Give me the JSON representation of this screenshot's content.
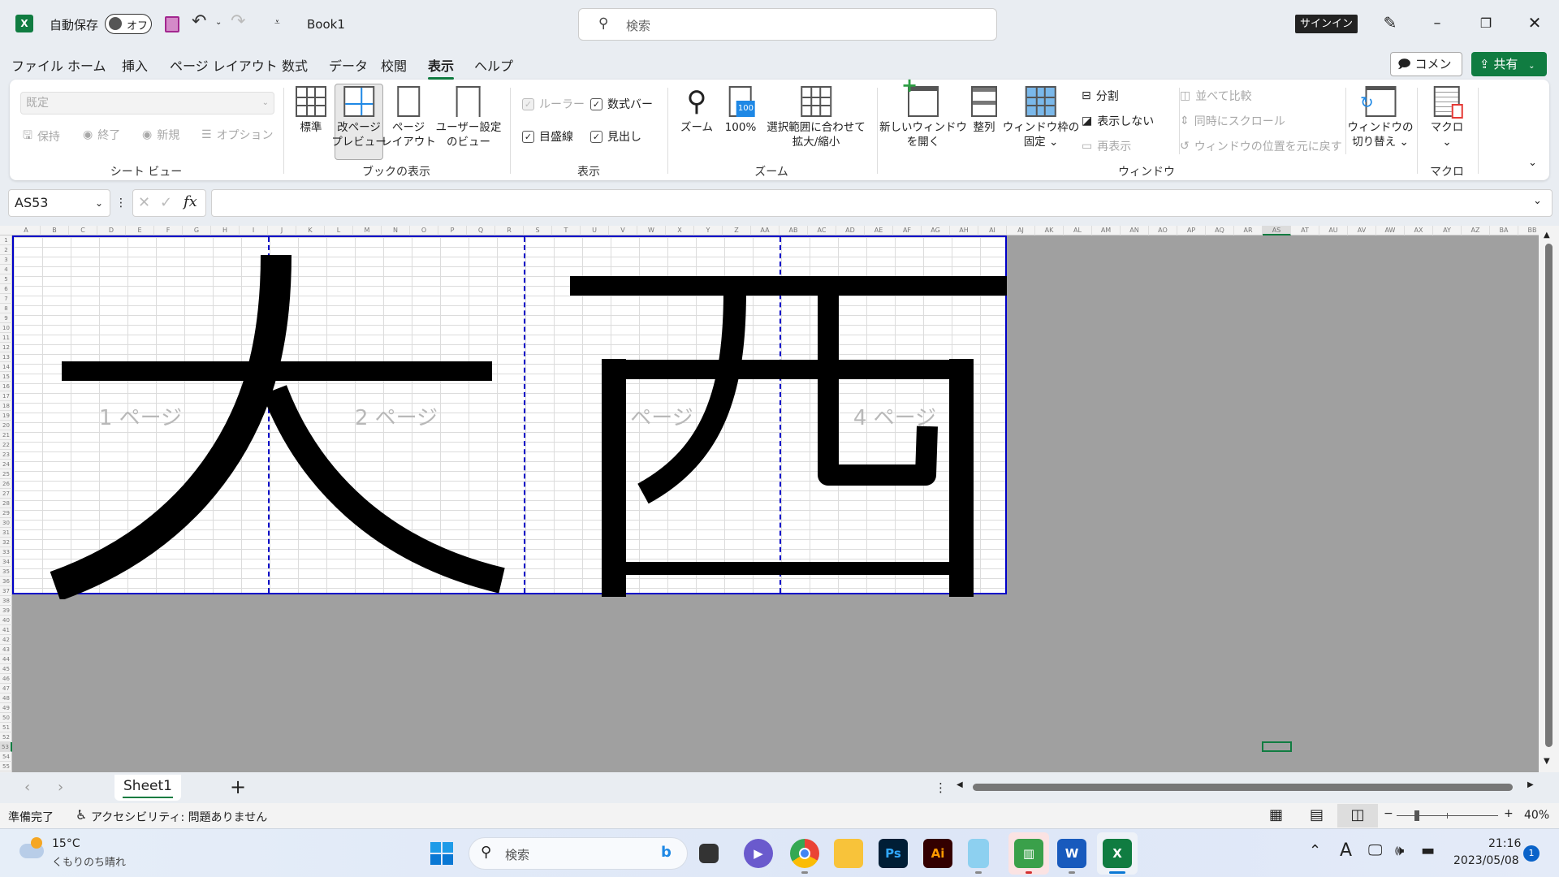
{
  "titlebar": {
    "autosave_label": "自動保存",
    "autosave_state": "オフ",
    "doc_title": "Book1",
    "search_placeholder": "検索",
    "signin": "サインイン"
  },
  "menu": {
    "tabs": [
      "ファイル",
      "ホーム",
      "挿入",
      "ページ レイアウト",
      "数式",
      "データ",
      "校閲",
      "表示",
      "ヘルプ"
    ],
    "active_tab": "表示",
    "comment": "コメント",
    "share": "共有"
  },
  "ribbon": {
    "sheet_view": {
      "combo_value": "既定",
      "keep": "保持",
      "exit": "終了",
      "new": "新規",
      "options": "オプション",
      "label": "シート ビュー"
    },
    "workbook_views": {
      "normal": "標準",
      "page_break_1": "改ページ",
      "page_break_2": "プレビュー",
      "page_layout_1": "ページ",
      "page_layout_2": "レイアウト",
      "custom_1": "ユーザー設定",
      "custom_2": "のビュー",
      "label": "ブックの表示"
    },
    "show": {
      "ruler": "ルーラー",
      "formula_bar": "数式バー",
      "gridlines": "目盛線",
      "headings": "見出し",
      "label": "表示",
      "ruler_checked": true,
      "formula_bar_checked": true,
      "gridlines_checked": true,
      "headings_checked": true
    },
    "zoom": {
      "zoom": "ズーム",
      "hundred": "100%",
      "icon_badge": "100",
      "fit_1": "選択範囲に合わせて",
      "fit_2": "拡大/縮小",
      "label": "ズーム"
    },
    "window": {
      "new_1": "新しいウィンドウ",
      "new_2": "を開く",
      "arrange": "整列",
      "freeze_1": "ウィンドウ枠の",
      "freeze_2": "固定",
      "split": "分割",
      "hide": "表示しない",
      "unhide": "再表示",
      "side_by_side": "並べて比較",
      "sync_scroll": "同時にスクロール",
      "reset_pos": "ウィンドウの位置を元に戻す",
      "switch_1": "ウィンドウの",
      "switch_2": "切り替え",
      "label": "ウィンドウ"
    },
    "macros": {
      "macro": "マクロ",
      "label": "マクロ"
    }
  },
  "formula_bar": {
    "name_box": "AS53",
    "fx": "fx",
    "value": ""
  },
  "sheet": {
    "columns": [
      "A",
      "B",
      "C",
      "D",
      "E",
      "F",
      "G",
      "H",
      "I",
      "J",
      "K",
      "L",
      "M",
      "N",
      "O",
      "P",
      "Q",
      "R",
      "S",
      "T",
      "U",
      "V",
      "W",
      "X",
      "Y",
      "Z",
      "AA",
      "AB",
      "AC",
      "AD",
      "AE",
      "AF",
      "AG",
      "AH",
      "AI",
      "AJ",
      "AK",
      "AL",
      "AM",
      "AN",
      "AO",
      "AP",
      "AQ",
      "AR",
      "AS",
      "AT",
      "AU",
      "AV",
      "AW",
      "AX",
      "AY",
      "AZ",
      "BA",
      "BB"
    ],
    "rows": [
      1,
      2,
      3,
      4,
      5,
      6,
      7,
      8,
      9,
      10,
      11,
      12,
      13,
      14,
      15,
      16,
      17,
      18,
      19,
      20,
      21,
      22,
      23,
      24,
      25,
      26,
      27,
      28,
      29,
      30,
      31,
      32,
      33,
      34,
      35,
      36,
      37,
      38,
      39,
      40,
      41,
      42,
      43,
      44,
      45,
      46,
      47,
      48,
      49,
      50,
      51,
      52,
      53,
      54,
      55
    ],
    "selected_cell": "AS53",
    "page_labels": [
      "1 ページ",
      "2 ページ",
      "ページ",
      "4 ページ"
    ],
    "art_text": "大西",
    "page_border_color": "#0000c8"
  },
  "tabs": {
    "sheets": [
      "Sheet1"
    ],
    "active": "Sheet1",
    "add": "+"
  },
  "status": {
    "ready": "準備完了",
    "accessibility": "アクセシビリティ: 問題ありません",
    "zoom": "40%",
    "zoom_level_percent": 40,
    "view": "page-break-preview"
  },
  "taskbar": {
    "temp": "15°C",
    "weather": "くもりのち晴れ",
    "search": "検索",
    "time": "21:16",
    "date": "2023/05/08",
    "notification_count": "1",
    "apps": [
      "file-explorer-task-view",
      "teams-chat",
      "chrome",
      "folder",
      "photoshop",
      "illustrator",
      "notepad",
      "sheet-app",
      "word",
      "excel"
    ],
    "ps": "Ps",
    "ai": "Ai",
    "word": "W",
    "excel": "X"
  },
  "colors": {
    "excel_green": "#107c41",
    "page_break_blue": "#0000c8",
    "outside_print_area": "#a0a0a0"
  }
}
